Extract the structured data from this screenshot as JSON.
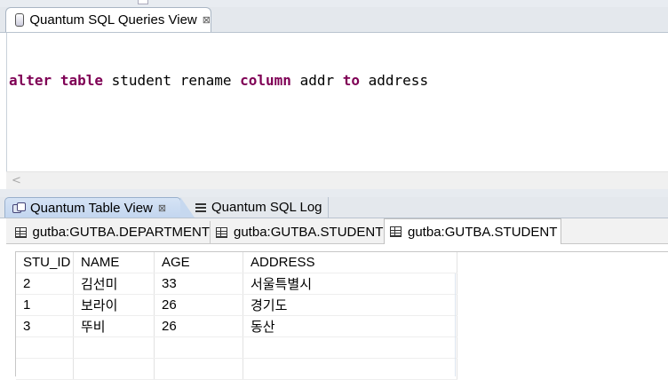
{
  "queries_view": {
    "tab_label": "Quantum SQL Queries View",
    "close_glyph": "⊠",
    "sql": {
      "kw1": "alter",
      "kw2": "table",
      "t1": "student rename",
      "kw3": "column",
      "t2": "addr",
      "kw4": "to",
      "t3": "address"
    },
    "scroll_left": "<"
  },
  "bottom_views": {
    "tabs": [
      {
        "label": "Quantum Table View",
        "active": true,
        "close_glyph": "⊠"
      },
      {
        "label": "Quantum SQL Log",
        "active": false
      }
    ]
  },
  "result_tabs": [
    {
      "label": "gutba:GUTBA.DEPARTMENT",
      "active": false
    },
    {
      "label": "gutba:GUTBA.STUDENT",
      "active": false
    },
    {
      "label": "gutba:GUTBA.STUDENT",
      "active": true
    }
  ],
  "table": {
    "columns": [
      "STU_ID",
      "NAME",
      "AGE",
      "ADDRESS"
    ],
    "rows": [
      [
        "2",
        "김선미",
        "33",
        "서울특별시"
      ],
      [
        "1",
        "보라이",
        "26",
        "경기도"
      ],
      [
        "3",
        "뚜비",
        "26",
        "동산"
      ]
    ]
  }
}
